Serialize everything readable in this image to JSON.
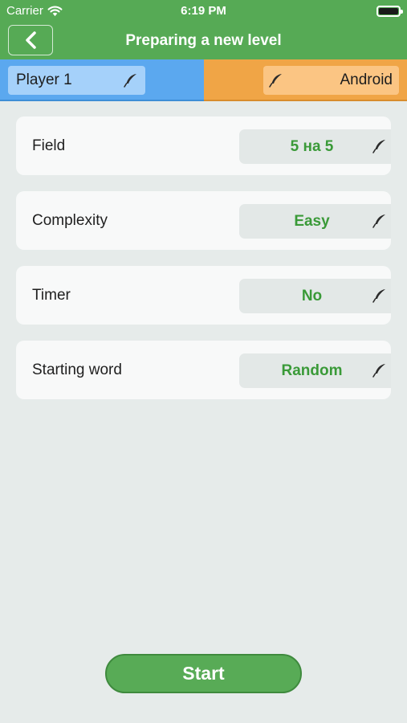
{
  "status_bar": {
    "carrier": "Carrier",
    "time": "6:19 PM"
  },
  "nav": {
    "title": "Preparing a new level"
  },
  "players": {
    "left": {
      "name": "Player 1"
    },
    "right": {
      "name": "Android"
    }
  },
  "settings": [
    {
      "label": "Field",
      "value": "5 на 5"
    },
    {
      "label": "Complexity",
      "value": "Easy"
    },
    {
      "label": "Timer",
      "value": "No"
    },
    {
      "label": "Starting word",
      "value": "Random"
    }
  ],
  "start_button": {
    "label": "Start"
  },
  "colors": {
    "header": "#56aa55",
    "player_left": "#5ba8ef",
    "player_right": "#f0a546",
    "value_text": "#3a9a38",
    "background": "#e6ebea"
  }
}
